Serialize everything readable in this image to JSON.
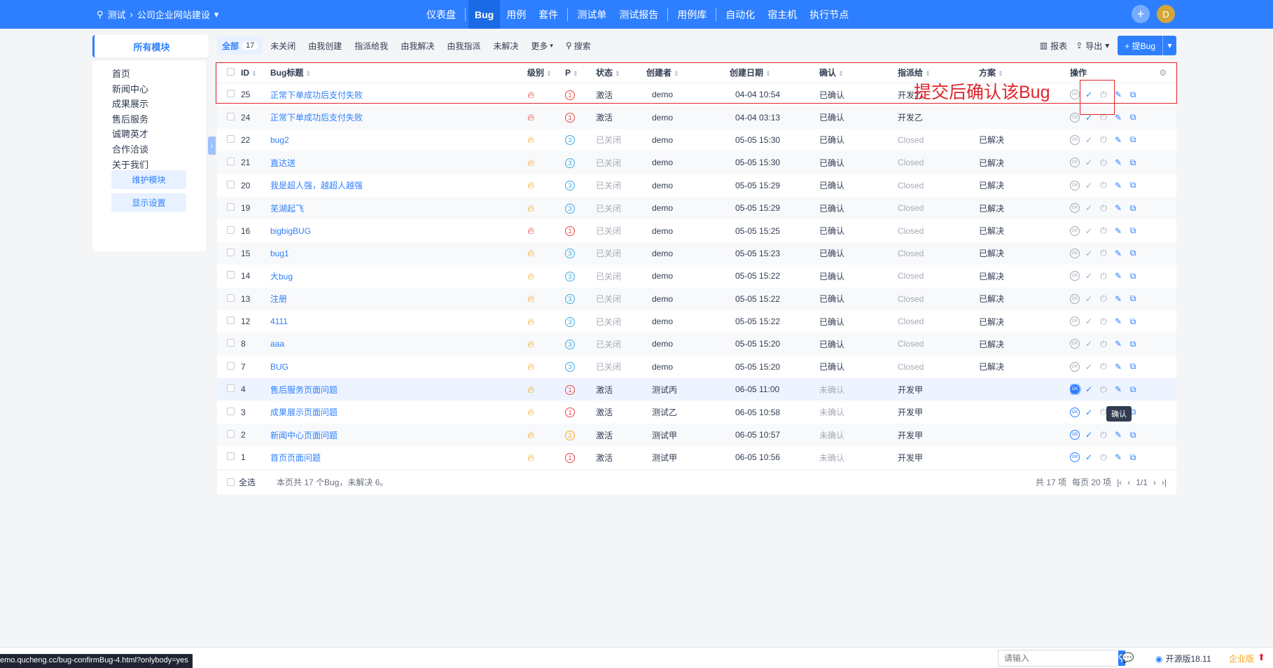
{
  "topbar": {
    "product_prefix": "测试",
    "product_name": "公司企业网站建设",
    "nav": [
      "仪表盘",
      "Bug",
      "用例",
      "套件",
      "测试单",
      "测试报告",
      "用例库",
      "自动化",
      "宿主机",
      "执行节点"
    ],
    "active_nav": "Bug",
    "avatar_letter": "D",
    "accent_color": "#2e7fff"
  },
  "sidebar": {
    "tab_label": "所有模块",
    "modules": [
      "首页",
      "新闻中心",
      "成果展示",
      "售后服务",
      "诚聘英才",
      "合作洽谈",
      "关于我们"
    ],
    "maintain_button": "维护模块",
    "display_button": "显示设置"
  },
  "filters": {
    "all_label": "全部",
    "all_count": "17",
    "items": [
      "未关闭",
      "由我创建",
      "指派给我",
      "由我解决",
      "由我指派",
      "未解决"
    ],
    "more_label": "更多",
    "search_label": "搜索"
  },
  "actions": {
    "report_label": "报表",
    "export_label": "导出",
    "create_label": "提Bug"
  },
  "table": {
    "headers": {
      "id": "ID",
      "title": "Bug标题",
      "severity": "级别",
      "priority": "P",
      "status": "状态",
      "creator": "创建者",
      "date": "创建日期",
      "confirmed": "确认",
      "assigned": "指派给",
      "resolution": "方案",
      "ops": "操作"
    },
    "rows": [
      {
        "id": "25",
        "title": "正常下单成功后支付失败",
        "severity": "red",
        "priority": "1",
        "status": "激活",
        "creator": "demo",
        "date": "04-04 10:54",
        "confirmed": "已确认",
        "assigned": "开发乙",
        "resolution": "",
        "active": true
      },
      {
        "id": "24",
        "title": "正常下单成功后支付失败",
        "severity": "red",
        "priority": "1",
        "status": "激活",
        "creator": "demo",
        "date": "04-04 03:13",
        "confirmed": "已确认",
        "assigned": "开发乙",
        "resolution": "",
        "active": true
      },
      {
        "id": "22",
        "title": "bug2",
        "severity": "orange",
        "priority": "3",
        "status": "已关闭",
        "creator": "demo",
        "date": "05-05 15:30",
        "confirmed": "已确认",
        "assigned": "Closed",
        "resolution": "已解决",
        "active": false
      },
      {
        "id": "21",
        "title": "直达送",
        "severity": "orange",
        "priority": "3",
        "status": "已关闭",
        "creator": "demo",
        "date": "05-05 15:30",
        "confirmed": "已确认",
        "assigned": "Closed",
        "resolution": "已解决",
        "active": false
      },
      {
        "id": "20",
        "title": "我是超人强，越超人越强",
        "severity": "orange",
        "priority": "3",
        "status": "已关闭",
        "creator": "demo",
        "date": "05-05 15:29",
        "confirmed": "已确认",
        "assigned": "Closed",
        "resolution": "已解决",
        "active": false
      },
      {
        "id": "19",
        "title": "芜湖起飞",
        "severity": "orange",
        "priority": "3",
        "status": "已关闭",
        "creator": "demo",
        "date": "05-05 15:29",
        "confirmed": "已确认",
        "assigned": "Closed",
        "resolution": "已解决",
        "active": false
      },
      {
        "id": "16",
        "title": "bigbigBUG",
        "severity": "red",
        "priority": "1",
        "status": "已关闭",
        "creator": "demo",
        "date": "05-05 15:25",
        "confirmed": "已确认",
        "assigned": "Closed",
        "resolution": "已解决",
        "active": false
      },
      {
        "id": "15",
        "title": "bug1",
        "severity": "orange",
        "priority": "3",
        "status": "已关闭",
        "creator": "demo",
        "date": "05-05 15:23",
        "confirmed": "已确认",
        "assigned": "Closed",
        "resolution": "已解决",
        "active": false
      },
      {
        "id": "14",
        "title": "大bug",
        "severity": "orange",
        "priority": "3",
        "status": "已关闭",
        "creator": "demo",
        "date": "05-05 15:22",
        "confirmed": "已确认",
        "assigned": "Closed",
        "resolution": "已解决",
        "active": false
      },
      {
        "id": "13",
        "title": "注册",
        "severity": "orange",
        "priority": "3",
        "status": "已关闭",
        "creator": "demo",
        "date": "05-05 15:22",
        "confirmed": "已确认",
        "assigned": "Closed",
        "resolution": "已解决",
        "active": false
      },
      {
        "id": "12",
        "title": "4111",
        "severity": "orange",
        "priority": "3",
        "status": "已关闭",
        "creator": "demo",
        "date": "05-05 15:22",
        "confirmed": "已确认",
        "assigned": "Closed",
        "resolution": "已解决",
        "active": false
      },
      {
        "id": "8",
        "title": "aaa",
        "severity": "orange",
        "priority": "3",
        "status": "已关闭",
        "creator": "demo",
        "date": "05-05 15:20",
        "confirmed": "已确认",
        "assigned": "Closed",
        "resolution": "已解决",
        "active": false
      },
      {
        "id": "7",
        "title": "BUG",
        "severity": "orange",
        "priority": "3",
        "status": "已关闭",
        "creator": "demo",
        "date": "05-05 15:20",
        "confirmed": "已确认",
        "assigned": "Closed",
        "resolution": "已解决",
        "active": false
      },
      {
        "id": "4",
        "title": "售后服务页面问题",
        "severity": "orange",
        "priority": "1",
        "status": "激活",
        "creator": "测试丙",
        "date": "06-05 11:00",
        "confirmed": "未确认",
        "assigned": "开发甲",
        "resolution": "",
        "active": true
      },
      {
        "id": "3",
        "title": "成果展示页面问题",
        "severity": "orange",
        "priority": "1",
        "status": "激活",
        "creator": "测试乙",
        "date": "06-05 10:58",
        "confirmed": "未确认",
        "assigned": "开发甲",
        "resolution": "",
        "active": true
      },
      {
        "id": "2",
        "title": "新闻中心页面问题",
        "severity": "orange",
        "priority": "2",
        "status": "激活",
        "creator": "测试甲",
        "date": "06-05 10:57",
        "confirmed": "未确认",
        "assigned": "开发甲",
        "resolution": "",
        "active": true
      },
      {
        "id": "1",
        "title": "首页页面问题",
        "severity": "orange",
        "priority": "1",
        "status": "激活",
        "creator": "测试甲",
        "date": "06-05 10:56",
        "confirmed": "未确认",
        "assigned": "开发甲",
        "resolution": "",
        "active": true
      }
    ]
  },
  "footer": {
    "select_all": "全选",
    "summary": "本页共 17 个Bug，未解决 6。",
    "total": "共 17 项",
    "per_page": "每页 20 项",
    "page": "1/1"
  },
  "annotation": {
    "text": "提交后确认该Bug",
    "color": "#e0242c"
  },
  "tooltip": "确认",
  "bottombar": {
    "search_placeholder": "请输入",
    "version": "开源版18.11",
    "edition": "企业版",
    "status_url": "emo.qucheng.cc/bug-confirmBug-4.html?onlybody=yes"
  }
}
